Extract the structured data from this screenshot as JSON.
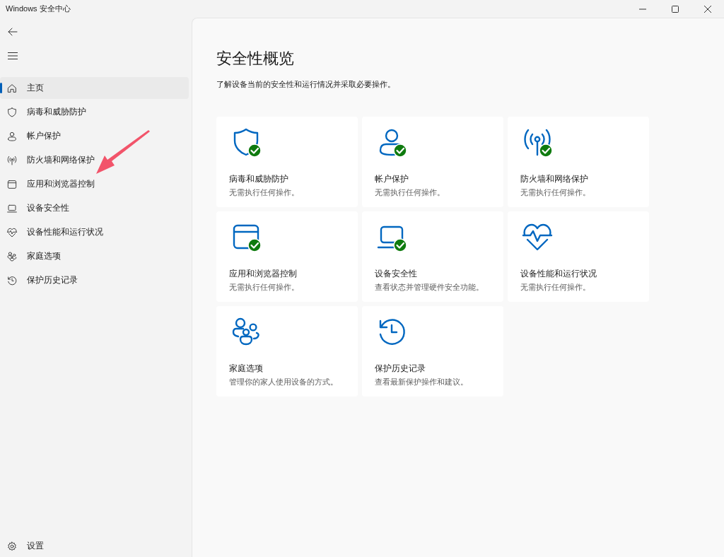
{
  "window": {
    "title": "Windows 安全中心"
  },
  "sidebar": {
    "items": [
      {
        "label": "主页",
        "kind": "home",
        "selected": true
      },
      {
        "label": "病毒和威胁防护",
        "kind": "shield",
        "selected": false
      },
      {
        "label": "帐户保护",
        "kind": "person",
        "selected": false
      },
      {
        "label": "防火墙和网络保护",
        "kind": "antenna",
        "selected": false
      },
      {
        "label": "应用和浏览器控制",
        "kind": "window",
        "selected": false
      },
      {
        "label": "设备安全性",
        "kind": "laptop",
        "selected": false
      },
      {
        "label": "设备性能和运行状况",
        "kind": "heart",
        "selected": false
      },
      {
        "label": "家庭选项",
        "kind": "family",
        "selected": false
      },
      {
        "label": "保护历史记录",
        "kind": "history",
        "selected": false
      }
    ],
    "settings": {
      "label": "设置",
      "kind": "gear"
    }
  },
  "annotation_arrow": true,
  "main": {
    "title": "安全性概览",
    "subtitle": "了解设备当前的安全性和运行情况并采取必要操作。",
    "tiles": [
      {
        "title": "病毒和威胁防护",
        "description": "无需执行任何操作。",
        "kind": "shield",
        "ok": true
      },
      {
        "title": "帐户保护",
        "description": "无需执行任何操作。",
        "kind": "person",
        "ok": true
      },
      {
        "title": "防火墙和网络保护",
        "description": "无需执行任何操作。",
        "kind": "antenna",
        "ok": true
      },
      {
        "title": "应用和浏览器控制",
        "description": "无需执行任何操作。",
        "kind": "window",
        "ok": true
      },
      {
        "title": "设备安全性",
        "description": "查看状态并管理硬件安全功能。",
        "kind": "laptop",
        "ok": true
      },
      {
        "title": "设备性能和运行状况",
        "description": "无需执行任何操作。",
        "kind": "heart",
        "ok": false
      },
      {
        "title": "家庭选项",
        "description": "管理你的家人使用设备的方式。",
        "kind": "family",
        "ok": false
      },
      {
        "title": "保护历史记录",
        "description": "查看最新保护操作和建议。",
        "kind": "history",
        "ok": false
      }
    ]
  }
}
